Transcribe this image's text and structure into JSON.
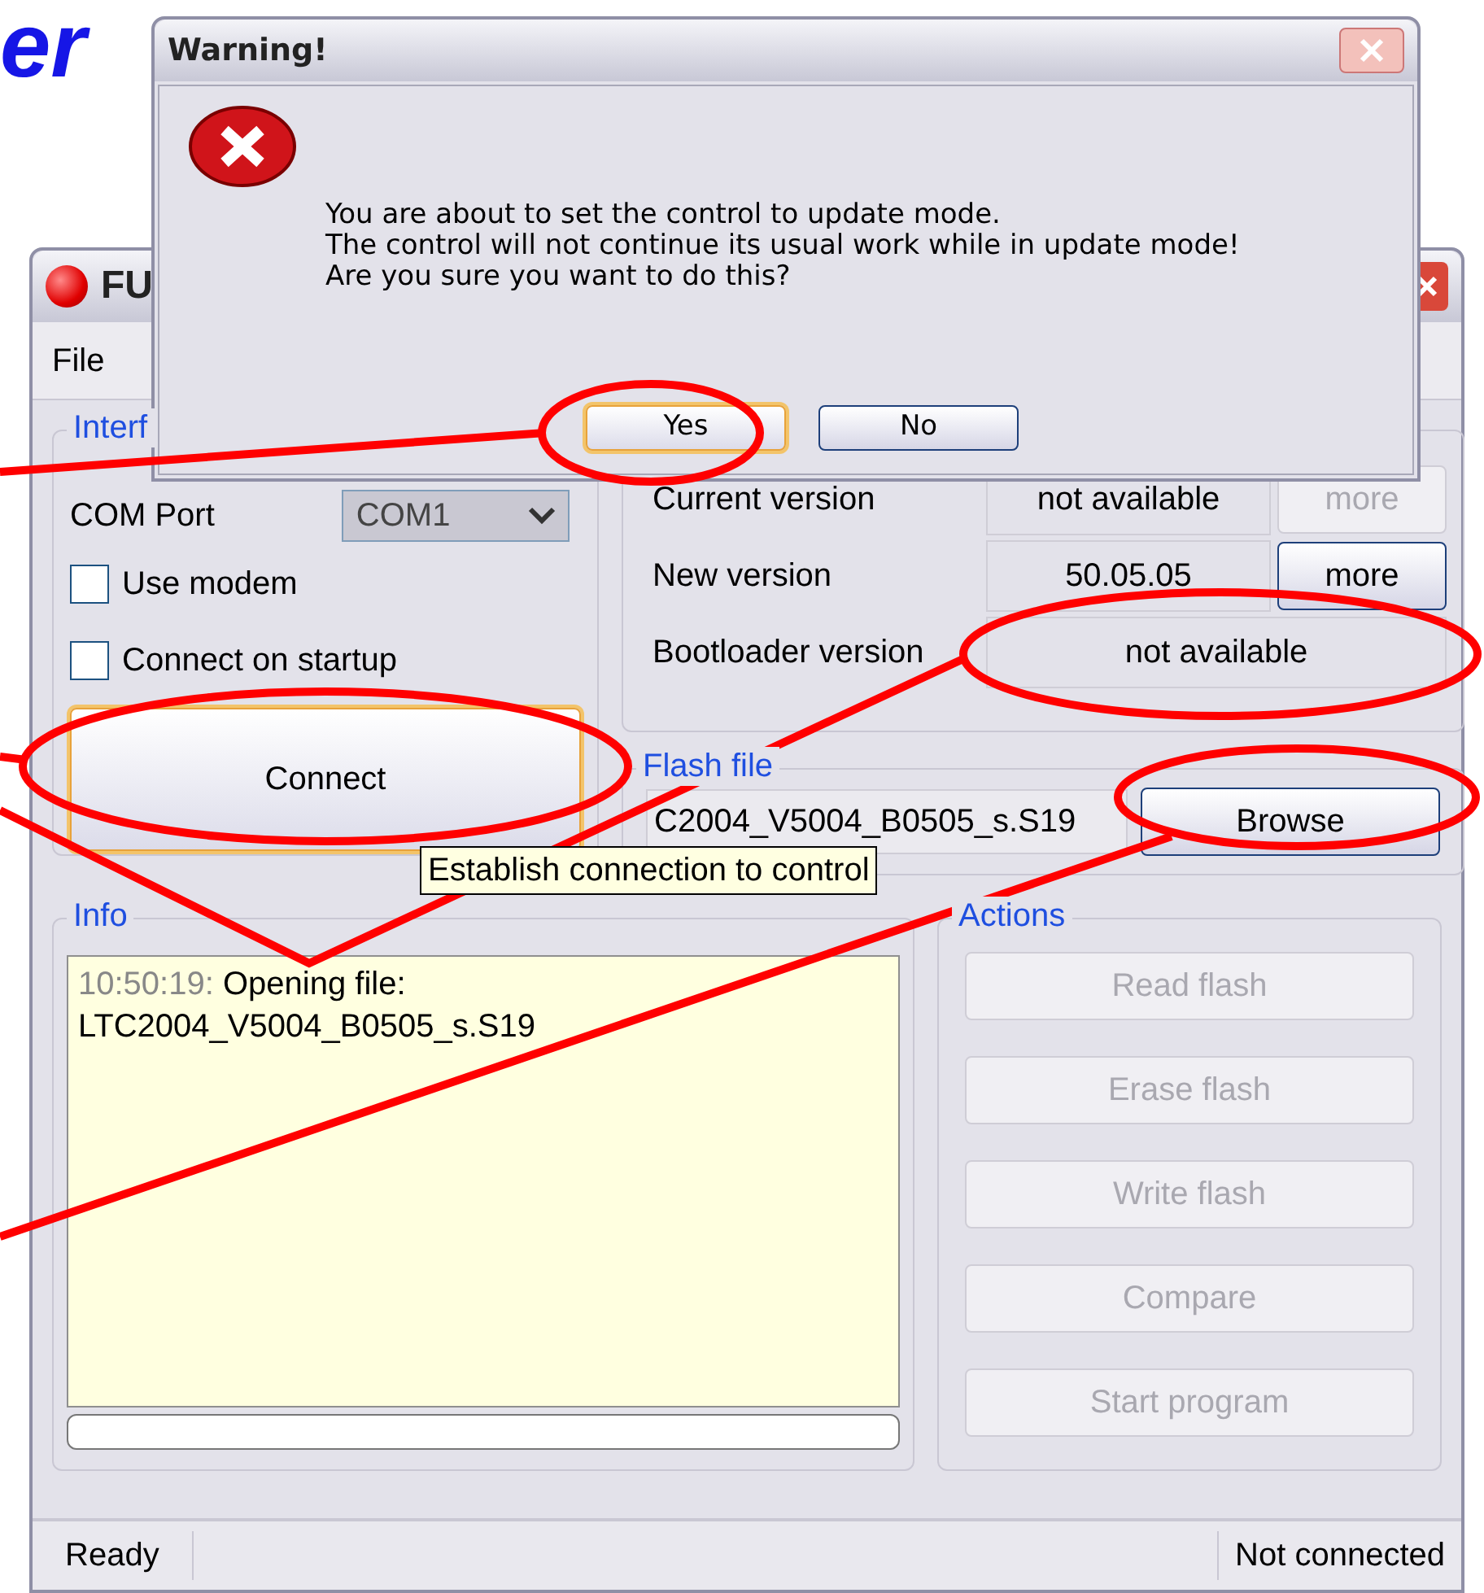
{
  "heading": "er",
  "main_window": {
    "title": "FU",
    "menu": [
      "File"
    ],
    "interface": {
      "title": "Interf",
      "com_label": "COM Port",
      "com_value": "COM1",
      "checkboxes": [
        {
          "label": "Use modem",
          "checked": false
        },
        {
          "label": "Connect on startup",
          "checked": false
        }
      ],
      "connect": "Connect"
    },
    "versions": [
      {
        "label": "Current version",
        "value": "not available",
        "button": {
          "label": "more",
          "disabled": true
        }
      },
      {
        "label": "New version",
        "value": "50.05.05",
        "button": {
          "label": "more",
          "disabled": false
        }
      },
      {
        "label": "Bootloader version",
        "value": "not available"
      }
    ],
    "flash_file": {
      "title": "Flash file",
      "value": "C2004_V5004_B0505_s.S19",
      "button": "Browse"
    },
    "info": {
      "title": "Info",
      "log": [
        {
          "time": "10:50:19:",
          "text": "Opening file: LTC2004_V5004_B0505_s.S19"
        }
      ],
      "progress": {
        "level": 0
      }
    },
    "actions": {
      "title": "Actions",
      "buttons": [
        {
          "label": "Read flash",
          "disabled": true
        },
        {
          "label": "Erase flash",
          "disabled": true
        },
        {
          "label": "Write flash",
          "disabled": true
        },
        {
          "label": "Compare",
          "disabled": true
        },
        {
          "label": "Start program",
          "disabled": true
        }
      ]
    },
    "status_bar": [
      "Ready",
      "Not connected"
    ]
  },
  "tooltip": "Establish connection to control",
  "dialog": {
    "title": "Warning!",
    "message": [
      "You are about to set the control to update mode.",
      "The control will not continue its usual work while in update mode!",
      "Are you sure you want to do this?"
    ],
    "buttons": [
      {
        "label": "Yes",
        "focused": true
      },
      {
        "label": "No",
        "focused": false
      }
    ]
  }
}
